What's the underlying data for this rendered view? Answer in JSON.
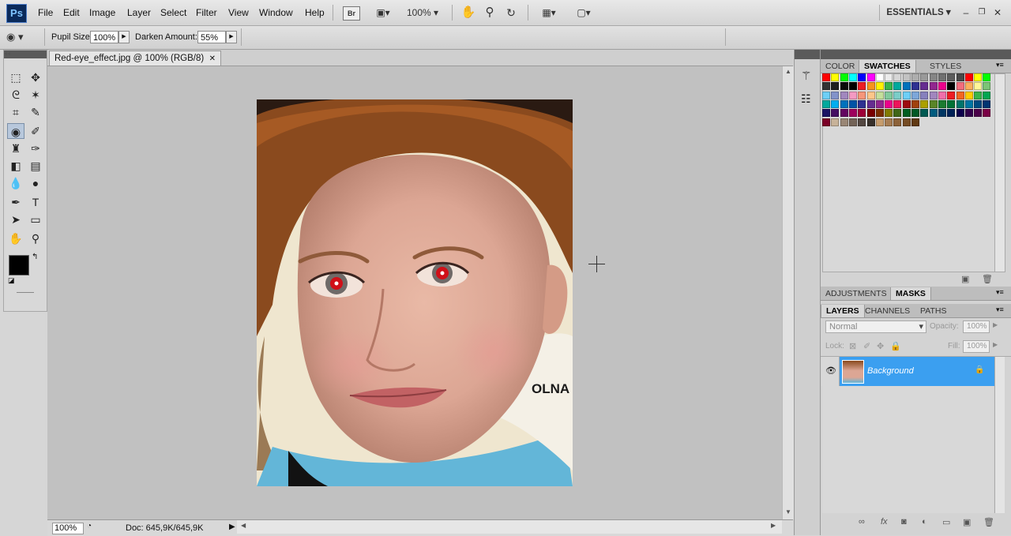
{
  "app": {
    "logo": "Ps"
  },
  "menu": [
    "File",
    "Edit",
    "Image",
    "Layer",
    "Select",
    "Filter",
    "View",
    "Window",
    "Help"
  ],
  "toolbar_top": {
    "bridge": "Br",
    "zoom": "100%",
    "workspace": "ESSENTIALS"
  },
  "options": {
    "pupil_label": "Pupil Size:",
    "pupil_value": "100%",
    "darken_label": "Darken Amount:",
    "darken_value": "55%"
  },
  "document": {
    "tab_title": "Red-eye_effect.jpg @ 100% (RGB/8)",
    "zoom": "100%",
    "doc_info": "Doc: 645,9K/645,9K",
    "photo_text": "OLNA"
  },
  "panels": {
    "top_tabs": [
      "COLOR",
      "SWATCHES",
      "STYLES"
    ],
    "mid_tabs": [
      "ADJUSTMENTS",
      "MASKS"
    ],
    "layer_tabs": [
      "LAYERS",
      "CHANNELS",
      "PATHS"
    ],
    "blend_mode": "Normal",
    "opacity_label": "Opacity:",
    "opacity_value": "100%",
    "lock_label": "Lock:",
    "fill_label": "Fill:",
    "fill_value": "100%",
    "layer_name": "Background"
  },
  "colors": {
    "accent": "#3b9ff0",
    "red_eye": "#d01018"
  },
  "swatch_colors": [
    "#ff0000",
    "#ffff00",
    "#00ff00",
    "#00ffff",
    "#0000ff",
    "#ff00ff",
    "#ffffff",
    "#ebebeb",
    "#d6d6d6",
    "#c2c2c2",
    "#adadad",
    "#999999",
    "#858585",
    "#707070",
    "#5c5c5c",
    "#474747",
    "#ff0000",
    "#ffff00",
    "#00ff00",
    "#333333",
    "#1f1f1f",
    "#0a0a0a",
    "#000000",
    "#ed1c24",
    "#f7941d",
    "#fff200",
    "#39b54a",
    "#00a99d",
    "#0072bc",
    "#2e3192",
    "#662d91",
    "#92278f",
    "#ec008c",
    "#000000",
    "#f26d7d",
    "#fbaf5d",
    "#fff799",
    "#7cc576",
    "#6dcff6",
    "#8393ca",
    "#a187be",
    "#f49ac2",
    "#f69679",
    "#fdc689",
    "#c4df9b",
    "#82ca9c",
    "#7bcdc8",
    "#6ecff6",
    "#7da7d9",
    "#8781bd",
    "#a186be",
    "#f06eaa",
    "#ed1c24",
    "#f26522",
    "#ffcc00",
    "#39b54a",
    "#00a651",
    "#00a99d",
    "#00aeef",
    "#0072bc",
    "#0054a6",
    "#2e3192",
    "#662d91",
    "#92278f",
    "#ec008c",
    "#ed145b",
    "#9e0b0f",
    "#a0410d",
    "#aba000",
    "#598527",
    "#1a7b30",
    "#007236",
    "#00746b",
    "#0076a3",
    "#004b80",
    "#003471",
    "#1b1464",
    "#440e62",
    "#630460",
    "#9e005d",
    "#9e0039",
    "#790000",
    "#7b2e00",
    "#827b00",
    "#406618",
    "#005e20",
    "#005826",
    "#005952",
    "#005b7f",
    "#003663",
    "#002157",
    "#0d004c",
    "#32004b",
    "#4b0049",
    "#7b0046",
    "#7a0026",
    "#c7b299",
    "#998675",
    "#736357",
    "#534741",
    "#37302a",
    "#c69c6d",
    "#a67c52",
    "#8c6239",
    "#754c24",
    "#603913"
  ],
  "tools": [
    [
      "marquee-tool-icon",
      "⬚"
    ],
    [
      "move-tool-icon",
      "✥"
    ],
    [
      "lasso-tool-icon",
      "ᘓ"
    ],
    [
      "magic-wand-icon",
      "✶"
    ],
    [
      "crop-tool-icon",
      "⌗"
    ],
    [
      "eyedropper-icon",
      "✎"
    ],
    [
      "red-eye-tool-icon",
      "◉"
    ],
    [
      "brush-tool-icon",
      "✐"
    ],
    [
      "stamp-tool-icon",
      "♜"
    ],
    [
      "history-brush-icon",
      "✑"
    ],
    [
      "eraser-icon",
      "◧"
    ],
    [
      "gradient-icon",
      "▤"
    ],
    [
      "blur-tool-icon",
      "💧"
    ],
    [
      "dodge-tool-icon",
      "●"
    ],
    [
      "pen-tool-icon",
      "✒"
    ],
    [
      "type-tool-icon",
      "T"
    ],
    [
      "path-select-icon",
      "➤"
    ],
    [
      "shape-tool-icon",
      "▭"
    ],
    [
      "hand-tool-icon",
      "✋"
    ],
    [
      "zoom-tool-icon",
      "⚲"
    ]
  ]
}
